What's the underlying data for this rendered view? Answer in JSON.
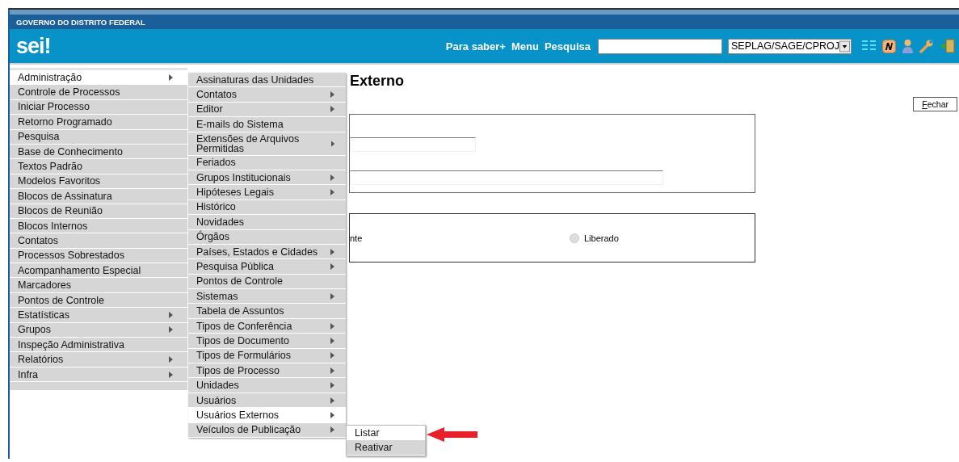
{
  "header": {
    "agency": "GOVERNO DO DISTRITO FEDERAL",
    "logo": "sei!",
    "links": [
      "Para saber+",
      "Menu",
      "Pesquisa"
    ],
    "unit_select": {
      "value": "SEPLAG/SAGE/CPROJ"
    }
  },
  "page": {
    "title": "Externo",
    "close_button": "Fechar",
    "status_fragment": "nte",
    "status_option": {
      "label": "Liberado",
      "selected": false
    }
  },
  "main_menu": [
    {
      "label": "Administração",
      "has_submenu": true,
      "selected": true
    },
    {
      "label": "Controle de Processos",
      "has_submenu": false,
      "selected": false
    },
    {
      "label": "Iniciar Processo",
      "has_submenu": false,
      "selected": false
    },
    {
      "label": "Retorno Programado",
      "has_submenu": false,
      "selected": false
    },
    {
      "label": "Pesquisa",
      "has_submenu": false,
      "selected": false
    },
    {
      "label": "Base de Conhecimento",
      "has_submenu": false,
      "selected": false
    },
    {
      "label": "Textos Padrão",
      "has_submenu": false,
      "selected": false
    },
    {
      "label": "Modelos Favoritos",
      "has_submenu": false,
      "selected": false
    },
    {
      "label": "Blocos de Assinatura",
      "has_submenu": false,
      "selected": false
    },
    {
      "label": "Blocos de Reunião",
      "has_submenu": false,
      "selected": false
    },
    {
      "label": "Blocos Internos",
      "has_submenu": false,
      "selected": false
    },
    {
      "label": "Contatos",
      "has_submenu": false,
      "selected": false
    },
    {
      "label": "Processos Sobrestados",
      "has_submenu": false,
      "selected": false
    },
    {
      "label": "Acompanhamento Especial",
      "has_submenu": false,
      "selected": false
    },
    {
      "label": "Marcadores",
      "has_submenu": false,
      "selected": false
    },
    {
      "label": "Pontos de Controle",
      "has_submenu": false,
      "selected": false
    },
    {
      "label": "Estatísticas",
      "has_submenu": true,
      "selected": false
    },
    {
      "label": "Grupos",
      "has_submenu": true,
      "selected": false
    },
    {
      "label": "Inspeção Administrativa",
      "has_submenu": false,
      "selected": false
    },
    {
      "label": "Relatórios",
      "has_submenu": true,
      "selected": false
    },
    {
      "label": "Infra",
      "has_submenu": true,
      "selected": false
    }
  ],
  "admin_submenu": [
    {
      "label": "Assinaturas das Unidades",
      "has_submenu": false,
      "selected": false
    },
    {
      "label": "Contatos",
      "has_submenu": true,
      "selected": false
    },
    {
      "label": "Editor",
      "has_submenu": true,
      "selected": false
    },
    {
      "label": "E-mails do Sistema",
      "has_submenu": false,
      "selected": false
    },
    {
      "label": "Extensões de Arquivos Permitidas",
      "has_submenu": true,
      "selected": false
    },
    {
      "label": "Feriados",
      "has_submenu": false,
      "selected": false
    },
    {
      "label": "Grupos Institucionais",
      "has_submenu": true,
      "selected": false
    },
    {
      "label": "Hipóteses Legais",
      "has_submenu": true,
      "selected": false
    },
    {
      "label": "Histórico",
      "has_submenu": false,
      "selected": false
    },
    {
      "label": "Novidades",
      "has_submenu": false,
      "selected": false
    },
    {
      "label": "Órgãos",
      "has_submenu": false,
      "selected": false
    },
    {
      "label": "Países, Estados e Cidades",
      "has_submenu": true,
      "selected": false
    },
    {
      "label": "Pesquisa Pública",
      "has_submenu": true,
      "selected": false
    },
    {
      "label": "Pontos de Controle",
      "has_submenu": false,
      "selected": false
    },
    {
      "label": "Sistemas",
      "has_submenu": true,
      "selected": false
    },
    {
      "label": "Tabela de Assuntos",
      "has_submenu": false,
      "selected": false
    },
    {
      "label": "Tipos de Conferência",
      "has_submenu": true,
      "selected": false
    },
    {
      "label": "Tipos de Documento",
      "has_submenu": true,
      "selected": false
    },
    {
      "label": "Tipos de Formulários",
      "has_submenu": true,
      "selected": false
    },
    {
      "label": "Tipos de Processo",
      "has_submenu": true,
      "selected": false
    },
    {
      "label": "Unidades",
      "has_submenu": true,
      "selected": false
    },
    {
      "label": "Usuários",
      "has_submenu": true,
      "selected": false
    },
    {
      "label": "Usuários Externos",
      "has_submenu": true,
      "selected": true
    },
    {
      "label": "Veículos de Publicação",
      "has_submenu": true,
      "selected": false
    }
  ],
  "external_users_submenu": [
    {
      "label": "Listar",
      "selected": true
    },
    {
      "label": "Reativar",
      "selected": false
    }
  ]
}
